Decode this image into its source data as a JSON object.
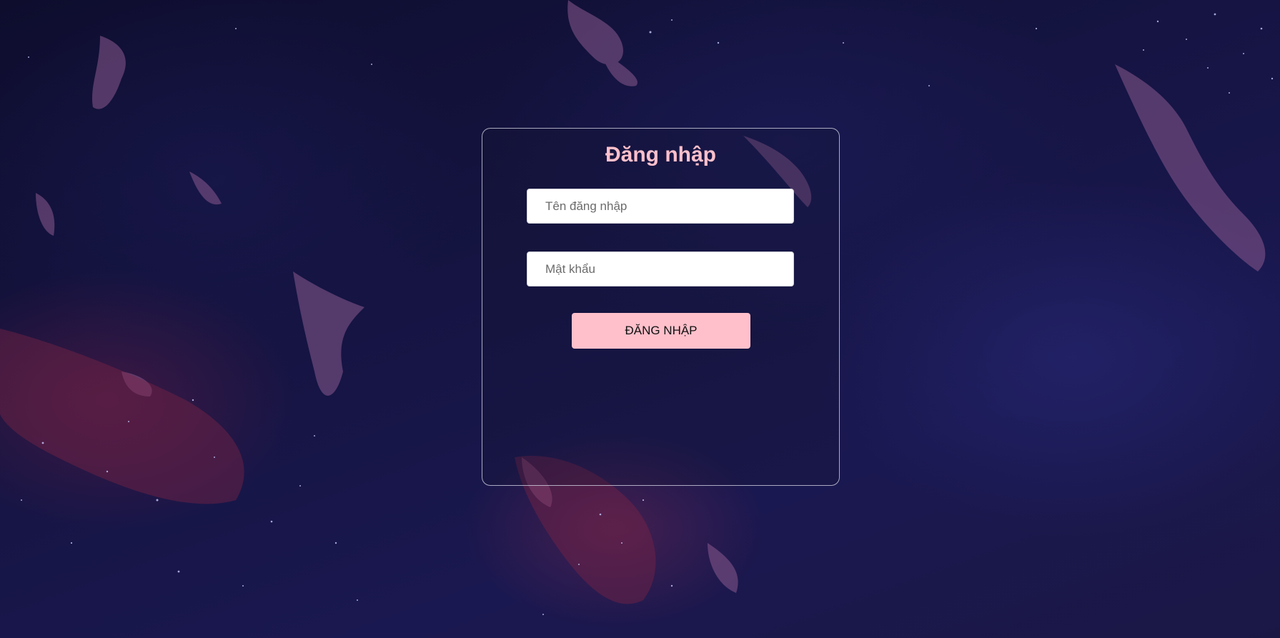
{
  "login": {
    "title": "Đăng nhập",
    "username_placeholder": "Tên đăng nhập",
    "username_value": "",
    "password_placeholder": "Mật khẩu",
    "password_value": "",
    "submit_label": "ĐĂNG NHẬP"
  },
  "colors": {
    "accent": "#ffc0cb",
    "background": "#151442"
  }
}
